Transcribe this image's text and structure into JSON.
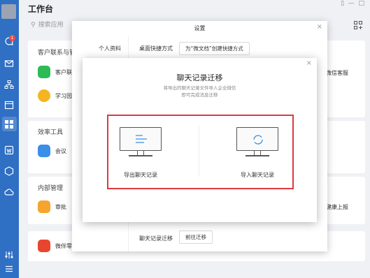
{
  "workbench": {
    "title": "工作台",
    "search_placeholder": "搜索应用",
    "sections": [
      {
        "title": "客户联系与管",
        "apps": [
          {
            "label": "客户联",
            "icon": "wechat-icon",
            "color": "#2dbb55"
          },
          {
            "label": "学习园",
            "icon": "school-icon",
            "color": "#f5b520"
          }
        ],
        "right_app": "微信客服"
      },
      {
        "title": "效率工具",
        "apps": [
          {
            "label": "会议",
            "icon": "cloud-meeting-icon",
            "color": "#3a8fe6"
          }
        ]
      },
      {
        "title": "内部管理",
        "apps": [
          {
            "label": "审批",
            "icon": "stamp-icon",
            "color": "#f5a52d"
          }
        ],
        "right_app": "健康上报"
      },
      {
        "apps": [
          {
            "label": "微伴零",
            "icon": "shop-icon",
            "color": "#e8452f"
          }
        ]
      }
    ]
  },
  "rail": {
    "badge": "1"
  },
  "settings": {
    "title": "设置",
    "nav_personal": "个人资料",
    "shortcut_label": "桌面快捷方式",
    "shortcut_button": "为“微文档”创建快捷方式",
    "migrate_label": "聊天记录迁移",
    "migrate_button": "前往迁移"
  },
  "migration": {
    "title": "聊天记录迁移",
    "desc_line1": "将导出的聊天记录文件导入企业微信",
    "desc_line2": "即可完成消息迁移",
    "export_label": "导出聊天记录",
    "import_label": "导入聊天记录"
  },
  "colors": {
    "rail": "#2f6fc4",
    "highlight_frame": "#e0393e"
  }
}
